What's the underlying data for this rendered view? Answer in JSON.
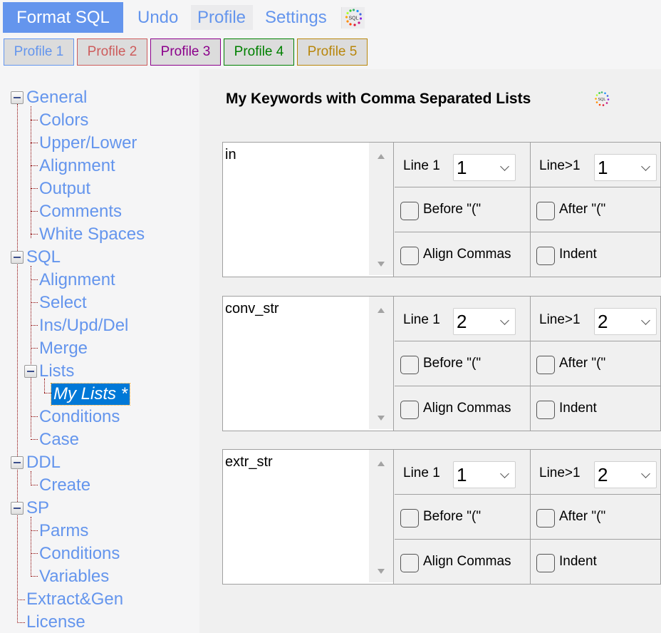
{
  "toolbar": {
    "format_label": "Format SQL",
    "undo_label": "Undo",
    "profile_label": "Profile",
    "settings_label": "Settings",
    "logo_text": "SQL"
  },
  "profiles": [
    {
      "label": "Profile 1",
      "color": "#6495ed"
    },
    {
      "label": "Profile 2",
      "color": "#cd5c5c"
    },
    {
      "label": "Profile 3",
      "color": "#8b008b"
    },
    {
      "label": "Profile 4",
      "color": "#008000"
    },
    {
      "label": "Profile 5",
      "color": "#b8860b"
    }
  ],
  "tree": {
    "general": {
      "label": "General",
      "children": [
        "Colors",
        "Upper/Lower",
        "Alignment",
        "Output",
        "Comments",
        "White Spaces"
      ]
    },
    "sql": {
      "label": "SQL",
      "children": [
        "Alignment",
        "Select",
        "Ins/Upd/Del",
        "Merge"
      ]
    },
    "lists": {
      "label": "Lists",
      "selected_child": "My Lists *"
    },
    "sql_after": [
      "Conditions",
      "Case"
    ],
    "ddl": {
      "label": "DDL",
      "children": [
        "Create"
      ]
    },
    "sp": {
      "label": "SP",
      "children": [
        "Parms",
        "Conditions",
        "Variables"
      ]
    },
    "extract": "Extract&Gen",
    "license": "License"
  },
  "main": {
    "title": "My Keywords with Comma Separated Lists",
    "logo_text": "SQL",
    "labels": {
      "line1": "Line 1",
      "line_gt1": "Line>1",
      "before": "Before \"(\"",
      "after": "After \"(\"",
      "align_commas": "Align Commas",
      "indent": "Indent"
    },
    "blocks": [
      {
        "keyword": "in",
        "line1": "1",
        "line_gt1": "1",
        "before": false,
        "after": false,
        "align_commas": false,
        "indent": false
      },
      {
        "keyword": "conv_str",
        "line1": "2",
        "line_gt1": "2",
        "before": false,
        "after": false,
        "align_commas": false,
        "indent": false
      },
      {
        "keyword": "extr_str",
        "line1": "1",
        "line_gt1": "2",
        "before": false,
        "after": false,
        "align_commas": false,
        "indent": false
      }
    ]
  }
}
